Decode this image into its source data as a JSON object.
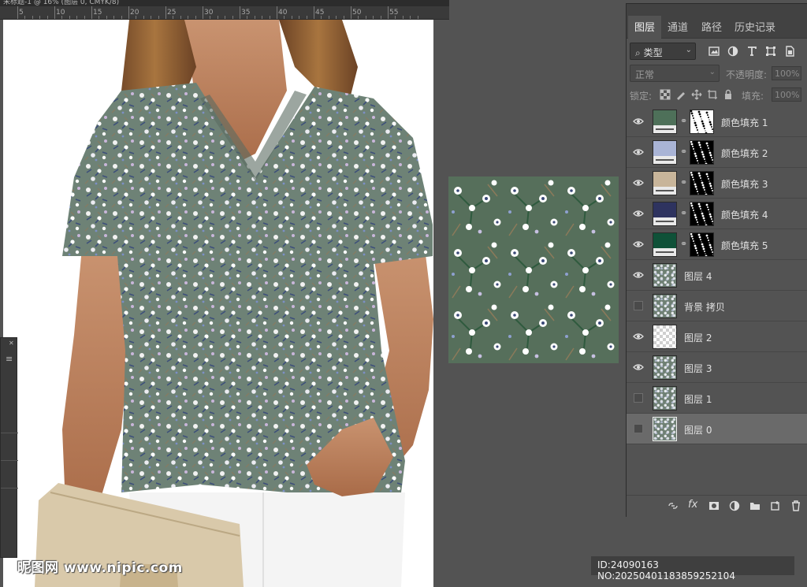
{
  "document": {
    "title": "未标题-1 @ 16% (图层 0, CMYK/8)",
    "ruler_ticks": [
      "5",
      "10",
      "15",
      "20",
      "25",
      "30",
      "35",
      "40",
      "45",
      "50",
      "55"
    ]
  },
  "panel": {
    "tabs": [
      "图层",
      "通道",
      "路径",
      "历史记录"
    ],
    "active_tab": "图层",
    "filter_label": "类型",
    "blend_mode": "正常",
    "opacity_label": "不透明度:",
    "opacity_value": "100%",
    "lock_label": "锁定:",
    "fill_label": "填充:",
    "fill_value": "100%",
    "layers": [
      {
        "name": "颜色填充 1",
        "visible": true,
        "kind": "fill",
        "color": "#4e7059",
        "mask": "white-speckle"
      },
      {
        "name": "颜色填充 2",
        "visible": true,
        "kind": "fill",
        "color": "#a9b4d6",
        "mask": "black-speckle"
      },
      {
        "name": "颜色填充 3",
        "visible": true,
        "kind": "fill",
        "color": "#c8b59a",
        "mask": "black-speckle"
      },
      {
        "name": "颜色填充 4",
        "visible": true,
        "kind": "fill",
        "color": "#2e335f",
        "mask": "black-speckle"
      },
      {
        "name": "颜色填充 5",
        "visible": true,
        "kind": "fill",
        "color": "#0f5138",
        "mask": "black-speckle"
      },
      {
        "name": "图层 4",
        "visible": true,
        "kind": "pattern"
      },
      {
        "name": "背景 拷贝",
        "visible": false,
        "kind": "pattern"
      },
      {
        "name": "图层 2",
        "visible": true,
        "kind": "transparent"
      },
      {
        "name": "图层 3",
        "visible": true,
        "kind": "pattern"
      },
      {
        "name": "图层 1",
        "visible": false,
        "kind": "pattern"
      },
      {
        "name": "图层 0",
        "visible": false,
        "kind": "pattern",
        "selected": true
      }
    ]
  },
  "colors": {
    "fabric": "#6e8276",
    "swatch_bg": "#566f5b",
    "skin": "#c48a63",
    "hair": "#8a5a34"
  },
  "watermark": {
    "left": "昵图网 www.nipic.com",
    "right": "ID:24090163 NO:20250401183859252104"
  }
}
